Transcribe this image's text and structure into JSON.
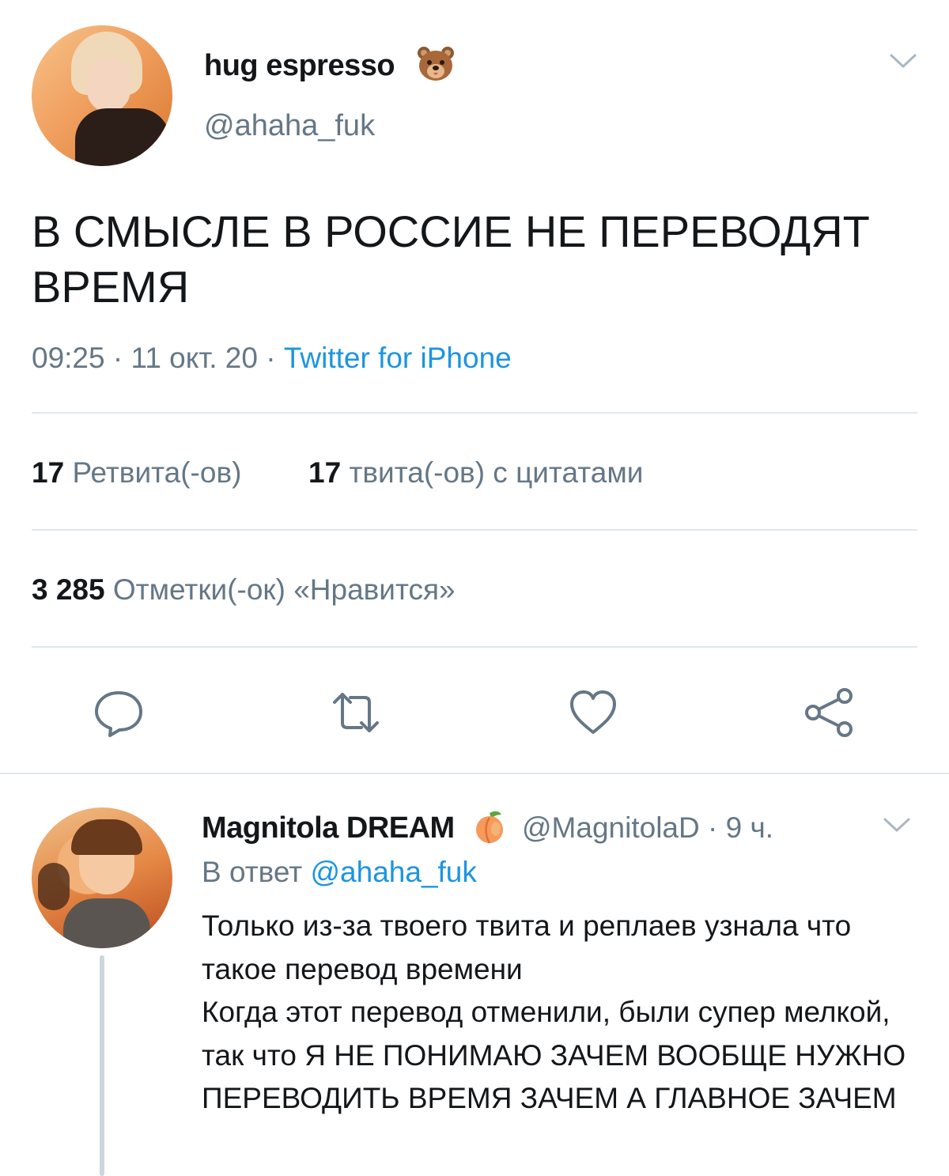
{
  "tweet": {
    "author": {
      "display_name": "hug espresso",
      "handle": "@ahaha_fuk",
      "emoji": "bear-face"
    },
    "text": "В СМЫСЛЕ В РОССИЕ НЕ ПЕРЕВОДЯТ ВРЕМЯ",
    "time": "09:25",
    "date": "11 окт. 20",
    "source": "Twitter for iPhone",
    "separator": " · ",
    "retweets": {
      "count": "17",
      "label": "Ретвита(-ов)"
    },
    "quotes": {
      "count": "17",
      "label": "твита(-ов) с цитатами"
    },
    "likes": {
      "count": "3 285",
      "label": "Отметки(-ок) «Нравится»"
    }
  },
  "actions": [
    "reply-icon",
    "retweet-icon",
    "like-icon",
    "share-icon"
  ],
  "reply": {
    "author": {
      "display_name": "Magnitola DREAM",
      "handle": "@MagnitolaD",
      "emoji": "peach"
    },
    "time_ago": "9 ч.",
    "separator": " · ",
    "reply_to_label": "В ответ",
    "reply_to_mention": "@ahaha_fuk",
    "text": "Только из-за твоего твита и реплаев узнала что такое перевод времени\nКогда этот перевод отменили, были супер мелкой, так что Я НЕ ПОНИМАЮ ЗАЧЕМ ВООБЩЕ НУЖНО ПЕРЕВОДИТЬ ВРЕМЯ ЗАЧЕМ А ГЛАВНОЕ ЗАЧЕМ"
  },
  "colors": {
    "text": "#14171a",
    "secondary": "#657786",
    "link": "#1b95e0",
    "divider": "#e1e8ed"
  }
}
